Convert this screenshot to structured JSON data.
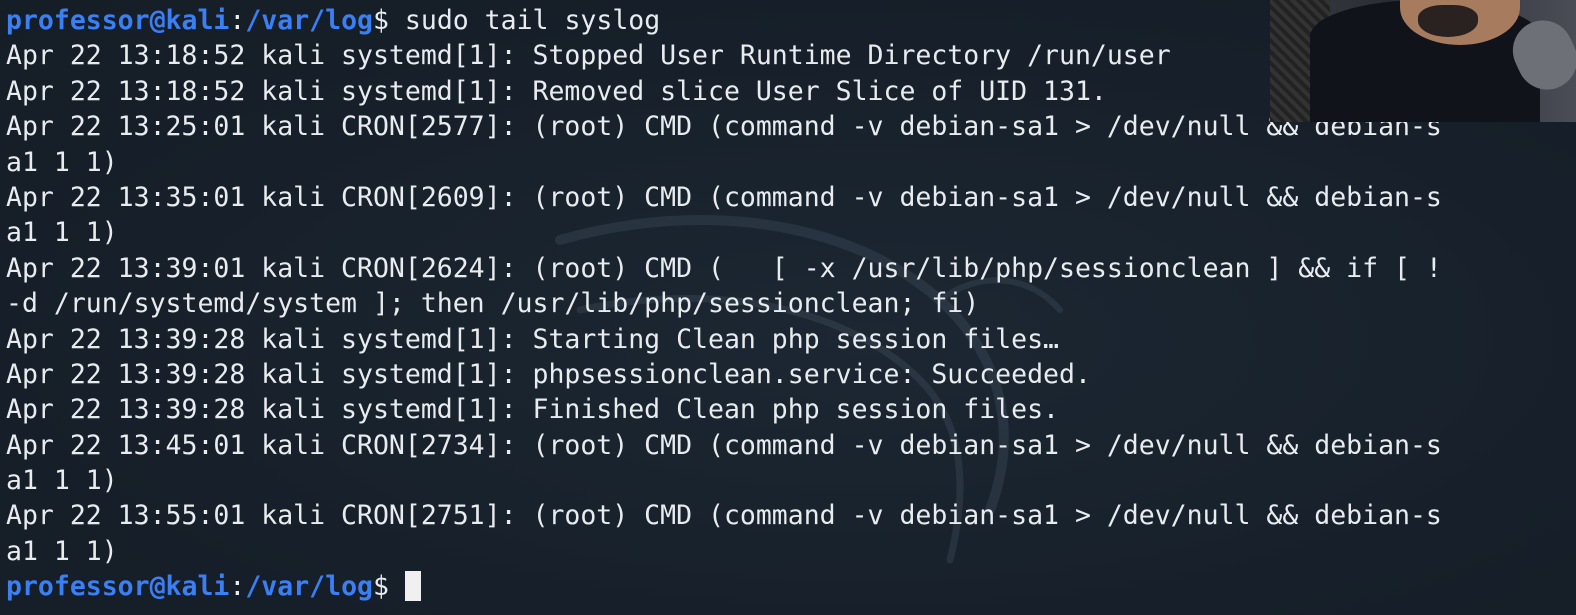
{
  "terminal": {
    "prompt": {
      "user_host": "professor@kali",
      "colon": ":",
      "path": "/var/log",
      "dollar": "$"
    },
    "command": " sudo tail syslog",
    "output": [
      "Apr 22 13:18:52 kali systemd[1]: Stopped User Runtime Directory /run/user",
      "Apr 22 13:18:52 kali systemd[1]: Removed slice User Slice of UID 131.",
      "Apr 22 13:25:01 kali CRON[2577]: (root) CMD (command -v debian-sa1 > /dev/null && debian-s",
      "a1 1 1)",
      "Apr 22 13:35:01 kali CRON[2609]: (root) CMD (command -v debian-sa1 > /dev/null && debian-s",
      "a1 1 1)",
      "Apr 22 13:39:01 kali CRON[2624]: (root) CMD (   [ -x /usr/lib/php/sessionclean ] && if [ !",
      "-d /run/systemd/system ]; then /usr/lib/php/sessionclean; fi)",
      "Apr 22 13:39:28 kali systemd[1]: Starting Clean php session files…",
      "Apr 22 13:39:28 kali systemd[1]: phpsessionclean.service: Succeeded.",
      "Apr 22 13:39:28 kali systemd[1]: Finished Clean php session files.",
      "Apr 22 13:45:01 kali CRON[2734]: (root) CMD (command -v debian-sa1 > /dev/null && debian-s",
      "a1 1 1)",
      "Apr 22 13:55:01 kali CRON[2751]: (root) CMD (command -v debian-sa1 > /dev/null && debian-s",
      "a1 1 1)"
    ]
  },
  "colors": {
    "background": "#17202a",
    "prompt_blue": "#3b7ff5",
    "text": "#e9ecef"
  }
}
